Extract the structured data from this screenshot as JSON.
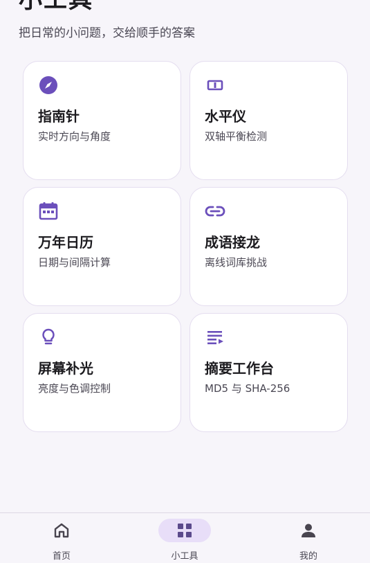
{
  "header": {
    "title": "小工具",
    "subtitle": "把日常的小问题，交给顺手的答案"
  },
  "accent_color": "#6b4fbb",
  "tools": [
    {
      "icon": "compass-icon",
      "title": "指南针",
      "desc": "实时方向与角度"
    },
    {
      "icon": "level-icon",
      "title": "水平仪",
      "desc": "双轴平衡检测"
    },
    {
      "icon": "calendar-icon",
      "title": "万年日历",
      "desc": "日期与间隔计算"
    },
    {
      "icon": "link-icon",
      "title": "成语接龙",
      "desc": "离线词库挑战"
    },
    {
      "icon": "lightbulb-icon",
      "title": "屏幕补光",
      "desc": "亮度与色调控制"
    },
    {
      "icon": "text-list-icon",
      "title": "摘要工作台",
      "desc": "MD5 与 SHA-256"
    }
  ],
  "bottom_nav": {
    "items": [
      {
        "icon": "home-icon",
        "label": "首页",
        "active": false
      },
      {
        "icon": "grid-icon",
        "label": "小工具",
        "active": true
      },
      {
        "icon": "person-icon",
        "label": "我的",
        "active": false
      }
    ]
  }
}
